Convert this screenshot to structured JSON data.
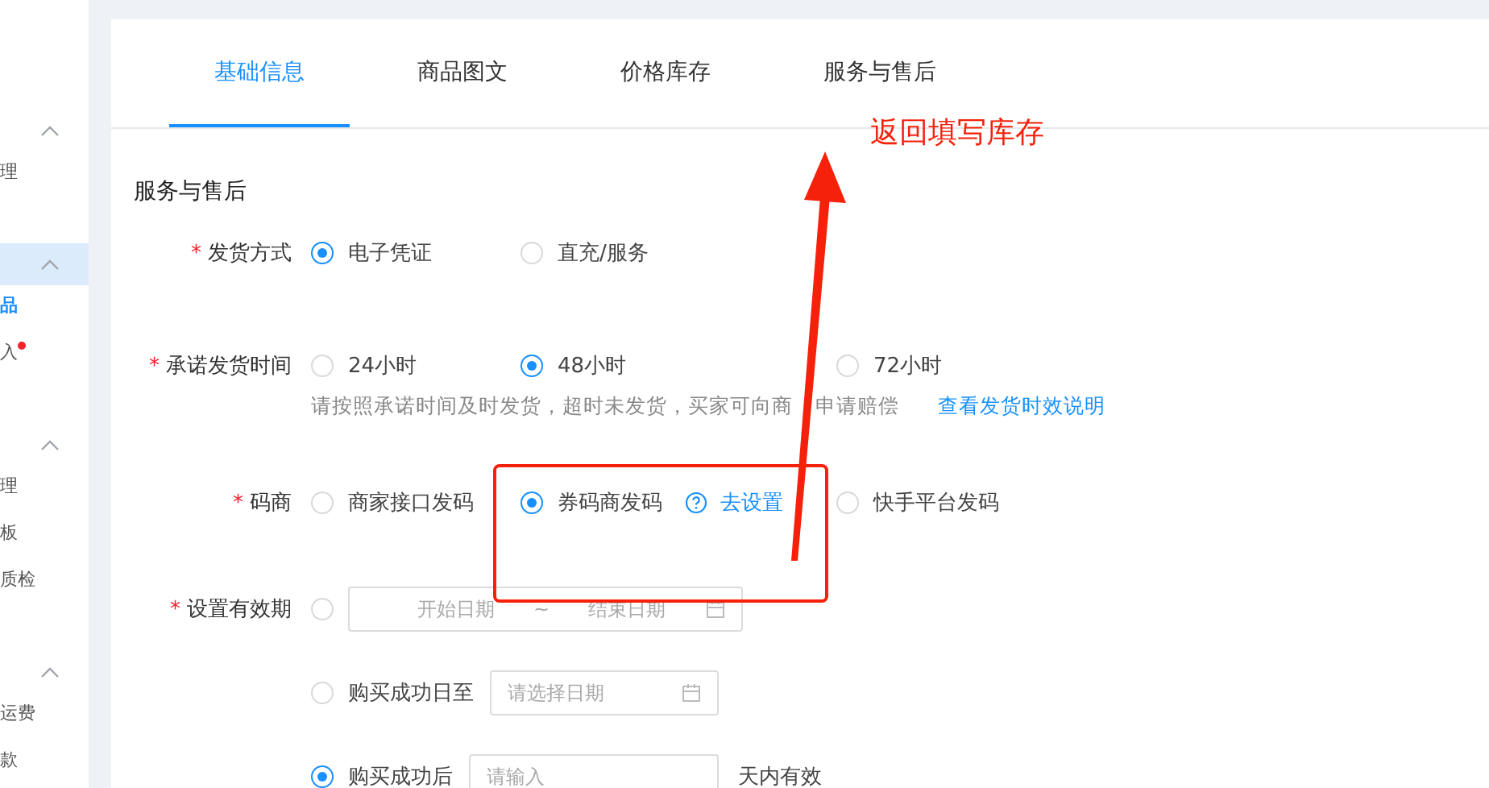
{
  "sidebar": {
    "groups": [
      {
        "expanded": true,
        "selected": false,
        "items": [
          {
            "label": "理",
            "selected": false,
            "dot": false
          }
        ]
      },
      {
        "expanded": true,
        "selected": true,
        "items": [
          {
            "label": "品",
            "selected": true,
            "dot": false
          },
          {
            "label": "入",
            "selected": false,
            "dot": true
          }
        ]
      },
      {
        "expanded": true,
        "selected": false,
        "items": [
          {
            "label": "理",
            "selected": false,
            "dot": false
          },
          {
            "label": "板",
            "selected": false,
            "dot": false
          },
          {
            "label": "质检",
            "selected": false,
            "dot": false
          }
        ]
      },
      {
        "expanded": true,
        "selected": false,
        "items": [
          {
            "label": "运费",
            "selected": false,
            "dot": false
          },
          {
            "label": "款",
            "selected": false,
            "dot": false
          }
        ]
      }
    ]
  },
  "tabs": [
    {
      "label": "基础信息",
      "selected": true
    },
    {
      "label": "商品图文",
      "selected": false
    },
    {
      "label": "价格库存",
      "selected": false
    },
    {
      "label": "服务与售后",
      "selected": false
    }
  ],
  "section_title": "服务与售后",
  "fields": [
    {
      "kind": "radio",
      "label": "发货方式",
      "required_mark": "*",
      "options": [
        {
          "label": "电子凭证",
          "selected": true
        },
        {
          "label": "直充/服务",
          "selected": false
        }
      ]
    },
    {
      "kind": "radio",
      "label": "承诺发货时间",
      "required_mark": "*",
      "options": [
        {
          "label": "24小时",
          "selected": false
        },
        {
          "label": "48小时",
          "selected": true
        },
        {
          "label": "72小时",
          "selected": false
        }
      ],
      "hint": [
        "请按照承诺时间及时发货，超时未发货，买家可向商",
        "申请赔偿"
      ],
      "hint_link": "查看发货时效说明"
    },
    {
      "kind": "radio",
      "label": "码商",
      "required_mark": "*",
      "options": [
        {
          "label": "商家接口发码",
          "selected": false
        },
        {
          "label": "券码商发码",
          "selected": true,
          "help_link": "去设置"
        },
        {
          "label": "快手平台发码",
          "selected": false
        }
      ]
    },
    {
      "kind": "validity",
      "label": "设置有效期",
      "required_mark": "*",
      "options": [
        {
          "kind": "range",
          "selected": false,
          "start_placeholder": "开始日期",
          "separator": "~",
          "end_placeholder": "结束日期"
        },
        {
          "kind": "date",
          "selected": false,
          "label": "购买成功日至",
          "placeholder": "请选择日期"
        },
        {
          "kind": "days",
          "selected": true,
          "label": "购买成功后",
          "placeholder": "请输入",
          "suffix": "天内有效"
        }
      ]
    }
  ],
  "annotation": {
    "text": "返回填写库存"
  }
}
